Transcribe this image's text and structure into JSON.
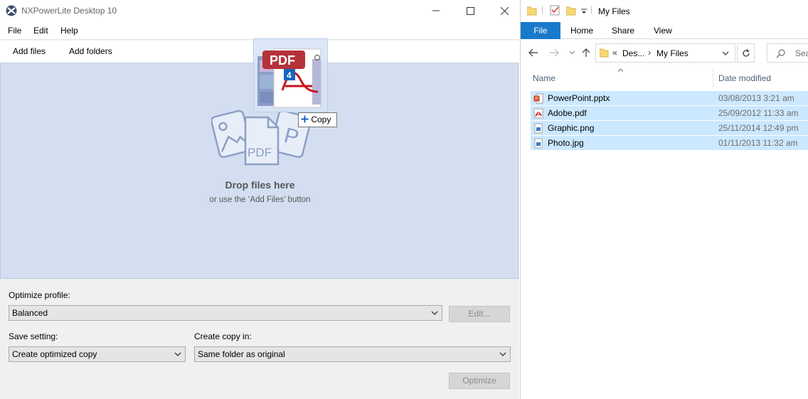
{
  "app": {
    "title": "NXPowerLite Desktop 10",
    "menu": [
      "File",
      "Edit",
      "Help"
    ],
    "toolbar": {
      "add_files": "Add files",
      "add_folders": "Add folders"
    },
    "dropzone": {
      "title": "Drop files here",
      "subtitle": "or use the ‘Add Files’ button",
      "illustration_label": "PDF"
    },
    "settings": {
      "optimize_profile_label": "Optimize profile:",
      "optimize_profile_value": "Balanced",
      "edit_label": "Edit...",
      "save_setting_label": "Save setting:",
      "save_setting_value": "Create optimized copy",
      "create_copy_label": "Create copy in:",
      "create_copy_value": "Same folder as original",
      "optimize_label": "Optimize"
    }
  },
  "drag": {
    "ghost_label": "PDF",
    "count": "4",
    "copy_tip": "Copy"
  },
  "explorer": {
    "title": "My Files",
    "ribbon": {
      "file": "File",
      "home": "Home",
      "share": "Share",
      "view": "View"
    },
    "address": {
      "prefix": "«",
      "parent": "Des...",
      "separator": "›",
      "current": "My Files"
    },
    "search_placeholder": "Sea",
    "columns": {
      "name": "Name",
      "date": "Date modified"
    },
    "files": [
      {
        "name": "PowerPoint.pptx",
        "date": "03/08/2013 3:21 am",
        "icon": "pptx-icon"
      },
      {
        "name": "Adobe.pdf",
        "date": "25/09/2012 11:33 am",
        "icon": "pdf-icon"
      },
      {
        "name": "Graphic.png",
        "date": "25/11/2014 12:49 pm",
        "icon": "image-icon"
      },
      {
        "name": "Photo.jpg",
        "date": "01/11/2013 11:32 am",
        "icon": "image-icon"
      }
    ]
  },
  "colors": {
    "accent": "#1979ca",
    "dropzone": "#d3dff0",
    "selection": "#cce8ff"
  }
}
